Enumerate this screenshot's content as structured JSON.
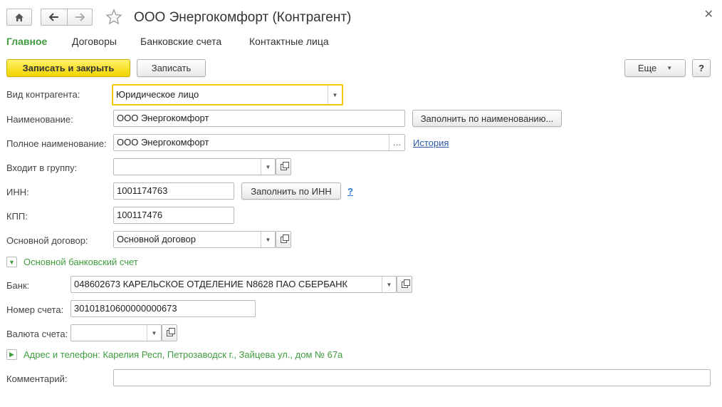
{
  "window": {
    "title": "ООО Энергокомфорт (Контрагент)"
  },
  "tabs": [
    {
      "label": "Главное"
    },
    {
      "label": "Договоры"
    },
    {
      "label": "Банковские счета"
    },
    {
      "label": "Контактные лица"
    }
  ],
  "toolbar": {
    "save_close_label": "Записать и закрыть",
    "save_label": "Записать",
    "more_label": "Еще",
    "help_label": "?"
  },
  "form": {
    "kind_label": "Вид контрагента:",
    "kind_value": "Юридическое лицо",
    "name_label": "Наименование:",
    "name_value": "ООО Энергокомфорт",
    "fill_by_name_label": "Заполнить по наименованию...",
    "full_name_label": "Полное наименование:",
    "full_name_value": "ООО Энергокомфорт",
    "history_link": "История",
    "group_label": "Входит в группу:",
    "group_value": "",
    "inn_label": "ИНН:",
    "inn_value": "1001174763",
    "fill_by_inn_label": "Заполнить по ИНН",
    "inn_help": "?",
    "kpp_label": "КПП:",
    "kpp_value": "100117476",
    "contract_label": "Основной договор:",
    "contract_value": "Основной договор"
  },
  "bank_section": {
    "title": "Основной банковский счет",
    "bank_label": "Банк:",
    "bank_value": "048602673 КАРЕЛЬСКОЕ ОТДЕЛЕНИЕ N8628 ПАО СБЕРБАНК",
    "account_label": "Номер счета:",
    "account_value": "30101810600000000673",
    "currency_label": "Валюта счета:",
    "currency_value": ""
  },
  "address_section": {
    "title": "Адрес и телефон: Карелия Респ, Петрозаводск г., Зайцева ул., дом № 67а"
  },
  "comment": {
    "label": "Комментарий:",
    "value": ""
  },
  "colors": {
    "accent_green": "#3f9c3f",
    "primary_button": "#f2d300",
    "focus_border": "#f2c600",
    "link_blue": "#2a5aa8"
  }
}
